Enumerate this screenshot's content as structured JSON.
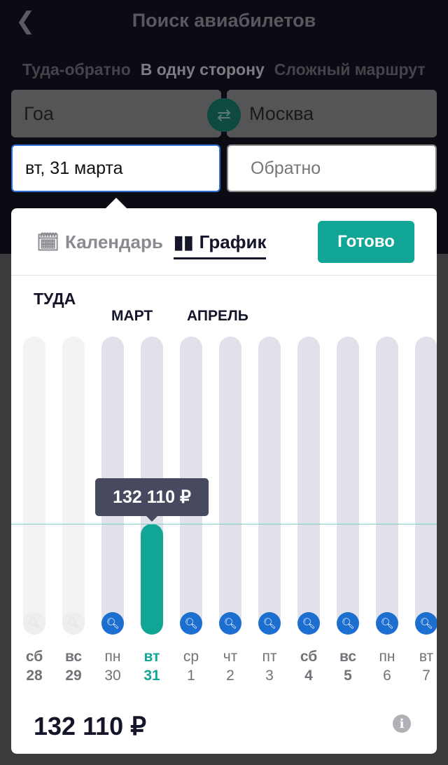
{
  "header": {
    "title": "Поиск авиабилетов",
    "back_icon": "chevron-left-icon"
  },
  "modes": [
    "Туда-обратно",
    "В одну сторону",
    "Сложный маршрут"
  ],
  "active_mode": 1,
  "from": "Гоа",
  "to": "Москва",
  "date": "вт, 31 марта",
  "return_placeholder": "Обратно",
  "picker": {
    "tab_calendar": "Календарь",
    "tab_graph": "График",
    "done": "Готово",
    "direction": "ТУДА",
    "month_march": "МАРТ",
    "month_april": "АПРЕЛЬ",
    "tooltip": "132 110 ₽",
    "price": "132 110 ₽",
    "accent": "#10a595",
    "search_color": "#1c6fd0",
    "days": [
      {
        "day": "сб",
        "date": "28",
        "weekend": true,
        "state": "past"
      },
      {
        "day": "вс",
        "date": "29",
        "weekend": true,
        "state": "past"
      },
      {
        "day": "пн",
        "date": "30",
        "weekend": false,
        "state": "search"
      },
      {
        "day": "вт",
        "date": "31",
        "weekend": false,
        "state": "selected"
      },
      {
        "day": "ср",
        "date": "1",
        "weekend": false,
        "state": "search"
      },
      {
        "day": "чт",
        "date": "2",
        "weekend": false,
        "state": "search"
      },
      {
        "day": "пт",
        "date": "3",
        "weekend": false,
        "state": "search"
      },
      {
        "day": "сб",
        "date": "4",
        "weekend": true,
        "state": "search"
      },
      {
        "day": "вс",
        "date": "5",
        "weekend": true,
        "state": "search"
      },
      {
        "day": "пн",
        "date": "6",
        "weekend": false,
        "state": "search"
      },
      {
        "day": "вт",
        "date": "7",
        "weekend": false,
        "state": "search"
      }
    ]
  }
}
